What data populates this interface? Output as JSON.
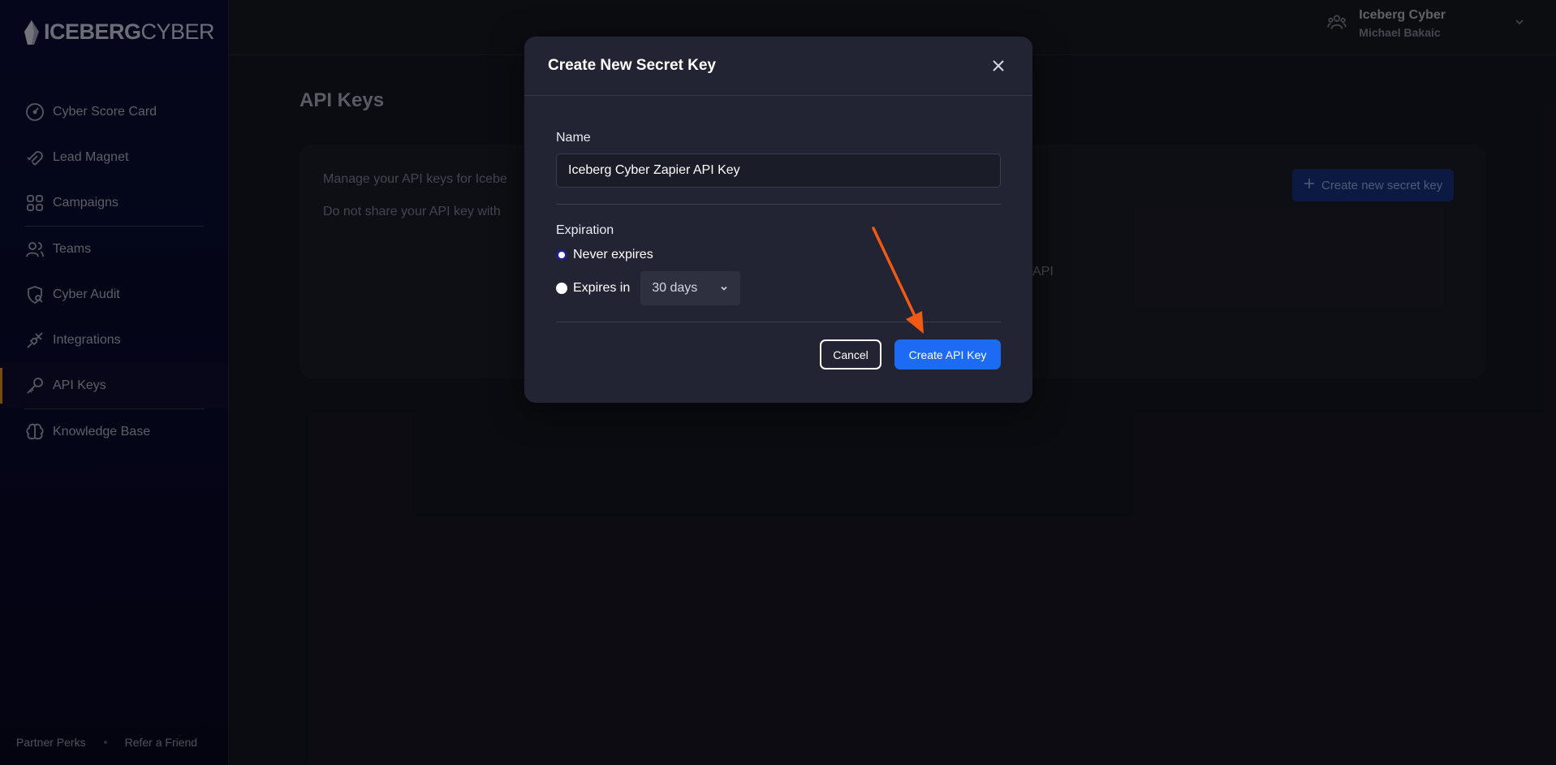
{
  "brand": {
    "bold": "ICEBERG",
    "light": "CYBER"
  },
  "sidebar": {
    "items": [
      {
        "label": "Cyber Score Card",
        "icon": "gauge-icon"
      },
      {
        "label": "Lead Magnet",
        "icon": "magnet-icon"
      },
      {
        "label": "Campaigns",
        "icon": "grid-icon"
      },
      {
        "label": "Teams",
        "icon": "users-icon"
      },
      {
        "label": "Cyber Audit",
        "icon": "shield-search-icon"
      },
      {
        "label": "Integrations",
        "icon": "plug-icon"
      },
      {
        "label": "API Keys",
        "icon": "key-icon",
        "active": true
      },
      {
        "label": "Knowledge Base",
        "icon": "brain-icon"
      }
    ],
    "footer": {
      "partner_perks": "Partner Perks",
      "refer": "Refer a Friend"
    }
  },
  "account": {
    "org": "Iceberg Cyber",
    "user": "Michael Bakaic"
  },
  "page": {
    "title": "API Keys",
    "desc1": "Manage your API keys for Icebe",
    "desc2": "Do not share your API key with",
    "desc3": "API",
    "create_secret_label": "Create new secret key"
  },
  "modal": {
    "title": "Create New Secret Key",
    "name_label": "Name",
    "name_value": "Iceberg Cyber Zapier API Key",
    "expiration_label": "Expiration",
    "never_expires": "Never expires",
    "expires_in": "Expires in",
    "expires_option": "30 days",
    "cancel": "Cancel",
    "create": "Create API Key"
  },
  "colors": {
    "accent": "#1d6af5",
    "arrow": "#f05a15",
    "active_marker": "#d98b1e"
  }
}
